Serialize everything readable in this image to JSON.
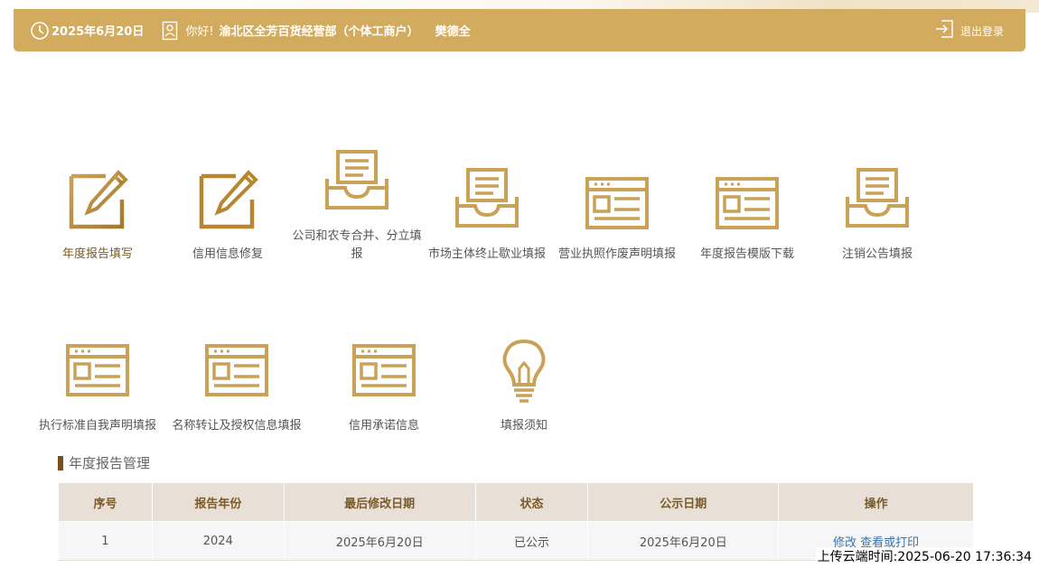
{
  "header": {
    "date": "2025年6月20日",
    "greeting": "你好!",
    "org_name": "渝北区全芳百货经营部（个体工商户）",
    "person": "樊德全",
    "logout": "退出登录"
  },
  "tiles": [
    {
      "label": "年度报告填写",
      "icon": "edit-icon"
    },
    {
      "label": "信用信息修复",
      "icon": "edit-icon"
    },
    {
      "label": "公司和农专合并、分立填报",
      "icon": "inbox-icon"
    },
    {
      "label": "市场主体终止歇业填报",
      "icon": "inbox-icon"
    },
    {
      "label": "营业执照作废声明填报",
      "icon": "browser-window-icon"
    },
    {
      "label": "年度报告模版下载",
      "icon": "browser-window-icon"
    },
    {
      "label": "注销公告填报",
      "icon": "inbox-icon"
    },
    {
      "label": "执行标准自我声明填报",
      "icon": "browser-window-icon"
    },
    {
      "label": "名称转让及授权信息填报",
      "icon": "browser-window-icon"
    },
    {
      "label": "信用承诺信息",
      "icon": "browser-window-icon"
    },
    {
      "label": "填报须知",
      "icon": "lightbulb-icon"
    }
  ],
  "section": {
    "title": "年度报告管理"
  },
  "table": {
    "headers": [
      "序号",
      "报告年份",
      "最后修改日期",
      "状态",
      "公示日期",
      "操作"
    ],
    "rows": [
      {
        "index": "1",
        "year": "2024",
        "modified": "2025年6月20日",
        "status": "已公示",
        "published": "2025年6月20日",
        "edit": "修改",
        "view": "查看或打印"
      }
    ]
  },
  "watermark": "上传云端时间:2025-06-20 17:36:34",
  "colors": {
    "accent": "#d2ab5f",
    "icon_gold": "#c9a257",
    "icon_gold_dark": "#b8862e",
    "link": "#3b73b0"
  }
}
